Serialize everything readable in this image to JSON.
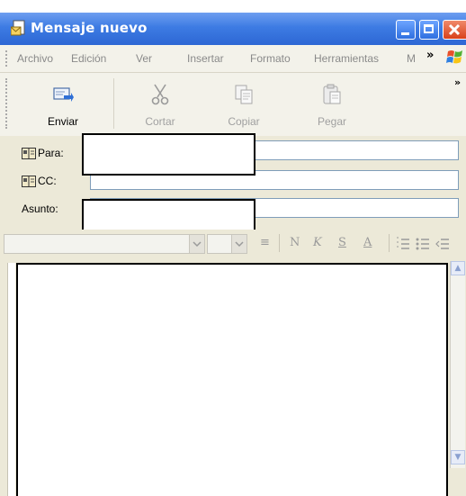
{
  "window": {
    "title": "Mensaje nuevo",
    "controls": {
      "minimize": "minimize",
      "maximize": "maximize",
      "close": "close"
    }
  },
  "menubar": {
    "items": [
      "Archivo",
      "Edición",
      "Ver",
      "Insertar",
      "Formato",
      "Herramientas",
      "M"
    ],
    "overflow": "»"
  },
  "toolbar": {
    "buttons": [
      {
        "label": "Enviar",
        "icon": "send-icon",
        "enabled": true
      },
      {
        "label": "Cortar",
        "icon": "scissors-icon",
        "enabled": false
      },
      {
        "label": "Copiar",
        "icon": "copy-icon",
        "enabled": false
      },
      {
        "label": "Pegar",
        "icon": "paste-icon",
        "enabled": false
      }
    ],
    "overflow": "»"
  },
  "header": {
    "to_label": "Para:",
    "cc_label": "CC:",
    "subject_label": "Asunto:",
    "to_value": "",
    "cc_value": "",
    "subject_value": ""
  },
  "format": {
    "bold": "N",
    "italic": "K",
    "underline": "S",
    "color": "A",
    "justify": "≡"
  },
  "colors": {
    "titlebar": "#2d67d4",
    "window_bg": "#ece9d8",
    "toolbar_bg": "#f3f2ea",
    "field_border": "#7f9db9"
  }
}
